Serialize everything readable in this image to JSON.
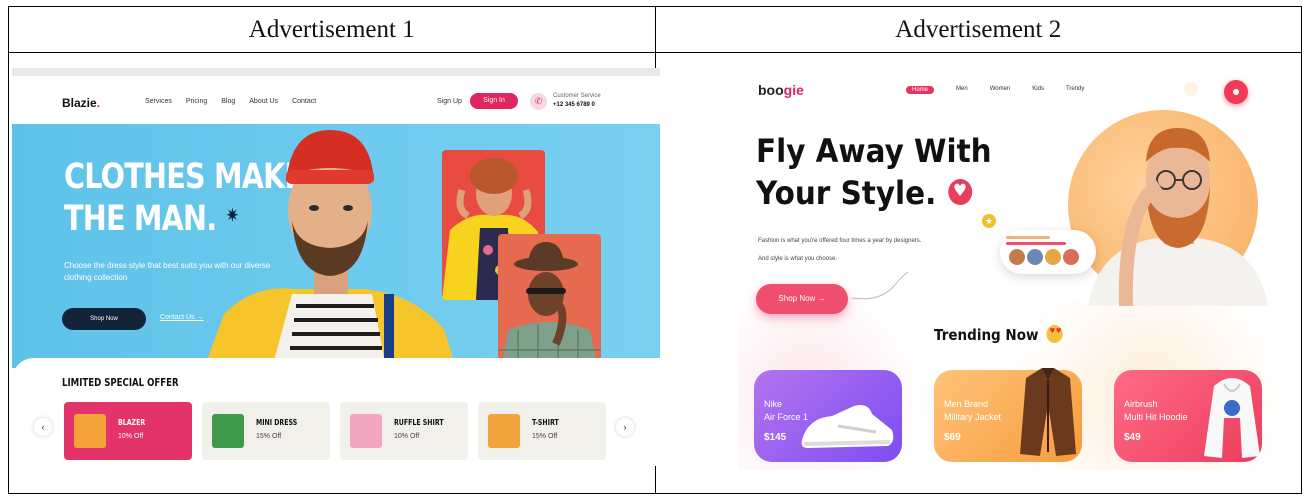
{
  "table": {
    "header_1": "Advertisement 1",
    "header_2": "Advertisement 2"
  },
  "ad1": {
    "logo": "Blazie",
    "logo_dot": ".",
    "nav": [
      "Services",
      "Pricing",
      "Blog",
      "About Us",
      "Contact"
    ],
    "sign_up": "Sign Up",
    "sign_in": "Sign In",
    "cs_label": "Customer Service",
    "cs_phone": "+12 345 6789 0",
    "hero_title_line1": "CLOTHES MAKE",
    "hero_title_line2": "THE MAN.",
    "hero_sub": "Choose the dress style that best suits you with our diverse clothing collection",
    "shop_now": "Shop Now",
    "contact_us": "Contact Us  →",
    "offer_title": "LIMITED SPECIAL OFFER",
    "prev": "‹",
    "next": "›",
    "products": [
      {
        "name": "BLAZER",
        "off": "10% Off"
      },
      {
        "name": "MINI DRESS",
        "off": "15% Off"
      },
      {
        "name": "RUFFLE SHIRT",
        "off": "10% Off"
      },
      {
        "name": "T-SHIRT",
        "off": "15% Off"
      }
    ],
    "colors": {
      "accent": "#e0245e",
      "hero": "#5ec2e8",
      "dark": "#13233a"
    }
  },
  "ad2": {
    "logo_main": "boo",
    "logo_accent": "gie",
    "nav": [
      "Home",
      "Men",
      "Women",
      "Kids",
      "Trendy"
    ],
    "title_line1": "Fly Away With",
    "title_line2": "Your Style.",
    "desc_line1": "Fashion is what you're offered four times a year by designers.",
    "desc_line2": "And style is what you choose.",
    "shop_now": "Shop Now  →",
    "trending": "Trending Now",
    "products": [
      {
        "line1": "Nike",
        "line2": "Air Force 1",
        "price": "$145"
      },
      {
        "line1": "Men Brand",
        "line2": "Military Jacket",
        "price": "$69"
      },
      {
        "line1": "Airbrush",
        "line2": "Multi Hit Hoodie",
        "price": "$49"
      }
    ],
    "colors": {
      "accent": "#ef4e6e",
      "orange": "#f7ad5f",
      "purple": "#7d4df0"
    }
  }
}
